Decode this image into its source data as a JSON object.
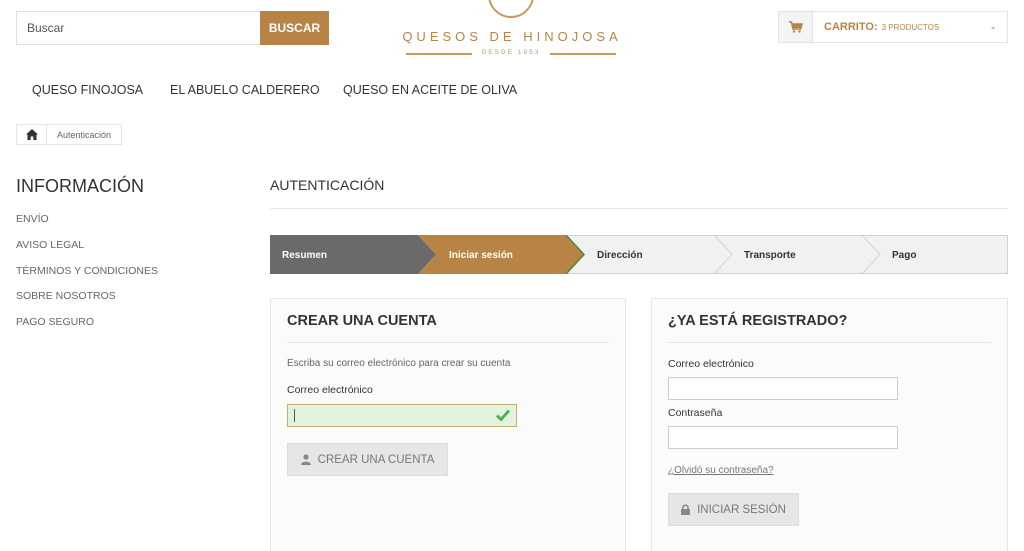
{
  "header": {
    "search_placeholder": "Buscar",
    "search_button": "BUSCAR",
    "logo_name": "QUESOS DE HINOJOSA",
    "logo_since": "DESDE 1953",
    "cart_label": "CARRITO:",
    "cart_count": "3 PRODUCTOS",
    "accent_color": "#b88446"
  },
  "nav": {
    "items": [
      "QUESO FINOJOSA",
      "EL ABUELO CALDERERO",
      "QUESO EN ACEITE DE OLIVA"
    ]
  },
  "breadcrumb": {
    "home_icon": "home-icon",
    "current": "Autenticación"
  },
  "sidebar": {
    "title": "INFORMACIÓN",
    "items": [
      "ENVÍO",
      "AVISO LEGAL",
      "TÉRMINOS Y CONDICIONES",
      "SOBRE NOSOTROS",
      "PAGO SEGURO"
    ]
  },
  "main": {
    "heading": "AUTENTICACIÓN",
    "steps": [
      {
        "label": "Resumen",
        "state": "done"
      },
      {
        "label": "Iniciar sesión",
        "state": "current"
      },
      {
        "label": "Dirección",
        "state": "todo"
      },
      {
        "label": "Transporte",
        "state": "todo"
      },
      {
        "label": "Pago",
        "state": "todo"
      }
    ],
    "create": {
      "title": "CREAR UNA CUENTA",
      "intro": "Escriba su correo electrónico para crear su cuenta",
      "email_label": "Correo electrónico",
      "email_value": "",
      "button": "CREAR UNA CUENTA"
    },
    "login": {
      "title": "¿YA ESTÁ REGISTRADO?",
      "email_label": "Correo electrónico",
      "password_label": "Contraseña",
      "forgot": "¿Olvidó su contraseña?",
      "button": "INICIAR SESIÓN"
    }
  }
}
